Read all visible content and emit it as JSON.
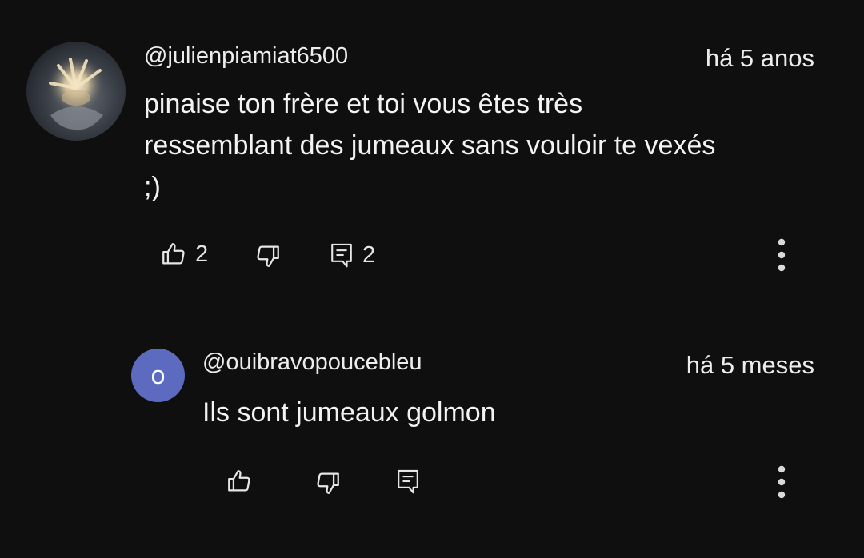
{
  "comment": {
    "author": "@julienpiamiat6500",
    "time": "há 5 anos",
    "text_lines": [
      "pinaise ton frère et toi vous êtes très",
      "ressemblant des jumeaux sans vouloir te vexés",
      ";)"
    ],
    "like_count": "2",
    "reply_count": "2",
    "icons": {
      "like": "thumbs-up-icon",
      "dislike": "thumbs-down-icon",
      "reply": "comment-icon",
      "menu": "more-vertical-icon"
    }
  },
  "reply": {
    "avatar_letter": "o",
    "avatar_color": "#5c6bc0",
    "author": "@ouibravopoucebleu",
    "time": "há 5 meses",
    "text": "Ils sont jumeaux golmon"
  },
  "colors": {
    "background": "#0f0f0f",
    "text": "#f1f1f1"
  }
}
